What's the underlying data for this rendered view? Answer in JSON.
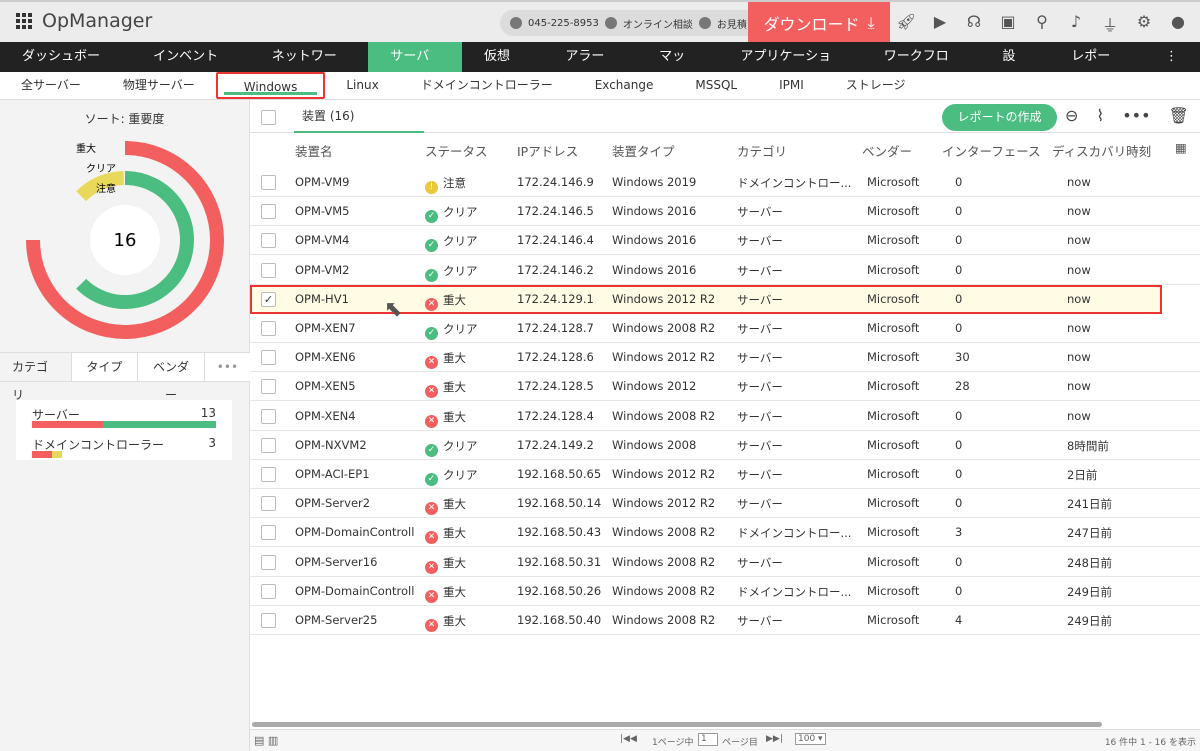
{
  "header": {
    "app_name": "OpManager",
    "phone": "045-225-8953",
    "online": "オンライン相談",
    "quote": "お見積り",
    "download": "ダウンロード"
  },
  "nav": [
    "ダッシュボード",
    "インベントリ",
    "ネットワーク",
    "サーバー",
    "仮想化",
    "アラート",
    "マップ",
    "アプリケーション",
    "ワークフロー",
    "設定",
    "レポート"
  ],
  "subnav": [
    "全サーバー",
    "物理サーバー",
    "Windows",
    "Linux",
    "ドメインコントローラー",
    "Exchange",
    "MSSQL",
    "IPMI",
    "ストレージ"
  ],
  "left": {
    "sort_label": "ソート: 重要度",
    "total": "16",
    "legend": [
      "重大",
      "クリア",
      "注意"
    ],
    "tabs": [
      "カテゴリ",
      "タイプ",
      "ベンダー"
    ],
    "categories": [
      {
        "name": "サーバー",
        "count": "13",
        "critical": 5,
        "clear": 8,
        "warning": 0
      },
      {
        "name": "ドメインコントローラー",
        "count": "3",
        "critical": 2,
        "clear": 0,
        "warning": 1
      }
    ],
    "donut": {
      "critical": 10,
      "clear": 5,
      "warning": 1
    }
  },
  "colors": {
    "critical": "#f35f5f",
    "clear": "#4bbd80",
    "warning": "#e8d95a"
  },
  "main": {
    "tab": "装置 (16)",
    "report_button": "レポートの作成",
    "columns": [
      "装置名",
      "ステータス",
      "IPアドレス",
      "装置タイプ",
      "カテゴリ",
      "ベンダー",
      "インターフェース",
      "ディスカバリ時刻"
    ],
    "rows": [
      [
        "OPM-VM9",
        "注意",
        "172.24.146.9",
        "Windows 2019",
        "ドメインコントロー...",
        "Microsoft",
        "0",
        "now"
      ],
      [
        "OPM-VM5",
        "クリア",
        "172.24.146.5",
        "Windows 2016",
        "サーバー",
        "Microsoft",
        "0",
        "now"
      ],
      [
        "OPM-VM4",
        "クリア",
        "172.24.146.4",
        "Windows 2016",
        "サーバー",
        "Microsoft",
        "0",
        "now"
      ],
      [
        "OPM-VM2",
        "クリア",
        "172.24.146.2",
        "Windows 2016",
        "サーバー",
        "Microsoft",
        "0",
        "now"
      ],
      [
        "OPM-HV1",
        "重大",
        "172.24.129.1",
        "Windows 2012 R2",
        "サーバー",
        "Microsoft",
        "0",
        "now"
      ],
      [
        "OPM-XEN7",
        "クリア",
        "172.24.128.7",
        "Windows 2008 R2",
        "サーバー",
        "Microsoft",
        "0",
        "now"
      ],
      [
        "OPM-XEN6",
        "重大",
        "172.24.128.6",
        "Windows 2012 R2",
        "サーバー",
        "Microsoft",
        "30",
        "now"
      ],
      [
        "OPM-XEN5",
        "重大",
        "172.24.128.5",
        "Windows 2012",
        "サーバー",
        "Microsoft",
        "28",
        "now"
      ],
      [
        "OPM-XEN4",
        "重大",
        "172.24.128.4",
        "Windows 2008 R2",
        "サーバー",
        "Microsoft",
        "0",
        "now"
      ],
      [
        "OPM-NXVM2",
        "クリア",
        "172.24.149.2",
        "Windows 2008",
        "サーバー",
        "Microsoft",
        "0",
        "8時間前"
      ],
      [
        "OPM-ACI-EP1",
        "クリア",
        "192.168.50.65",
        "Windows 2012 R2",
        "サーバー",
        "Microsoft",
        "0",
        "2日前"
      ],
      [
        "OPM-Server2",
        "重大",
        "192.168.50.14",
        "Windows 2012 R2",
        "サーバー",
        "Microsoft",
        "0",
        "241日前"
      ],
      [
        "OPM-DomainControll...",
        "重大",
        "192.168.50.43",
        "Windows 2008 R2",
        "ドメインコントロー...",
        "Microsoft",
        "3",
        "247日前"
      ],
      [
        "OPM-Server16",
        "重大",
        "192.168.50.31",
        "Windows 2008 R2",
        "サーバー",
        "Microsoft",
        "0",
        "248日前"
      ],
      [
        "OPM-DomainControll...",
        "重大",
        "192.168.50.26",
        "Windows 2008 R2",
        "ドメインコントロー...",
        "Microsoft",
        "0",
        "249日前"
      ],
      [
        "OPM-Server25",
        "重大",
        "192.168.50.40",
        "Windows 2008 R2",
        "サーバー",
        "Microsoft",
        "4",
        "249日前"
      ]
    ],
    "selected_row": 4
  },
  "footer": {
    "page_prefix": "1ページ中",
    "page": "1",
    "page_suffix": "ページ目",
    "per_page": "100",
    "summary": "16 件中 1 - 16 を表示"
  }
}
